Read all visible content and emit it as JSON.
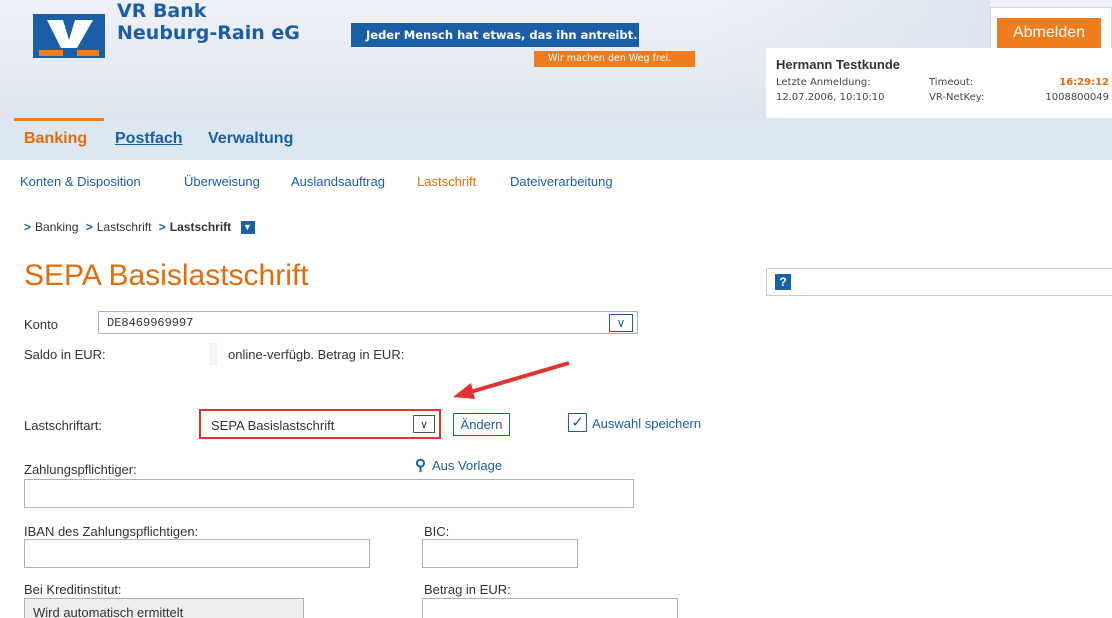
{
  "header": {
    "bank_name_line1": "VR Bank",
    "bank_name_line2": "Neuburg-Rain eG",
    "slogan": "Jeder Mensch hat etwas, das ihn antreibt.",
    "slogan_sub": "Wir machen den Weg frei.",
    "logout_label": "Abmelden"
  },
  "user": {
    "name": "Hermann Testkunde",
    "last_login_label": "Letzte Anmeldung:",
    "last_login_value": "12.07.2006, 10:10:10",
    "timeout_label": "Timeout:",
    "timeout_value": "16:29:12",
    "netkey_label": "VR-NetKey:",
    "netkey_value": "1008800049"
  },
  "mainnav": {
    "tabs": [
      "Banking",
      "Postfach",
      "Verwaltung"
    ],
    "active": "Banking"
  },
  "subnav": {
    "items": [
      "Konten & Disposition",
      "Überweisung",
      "Auslandsauftrag",
      "Lastschrift",
      "Dateiverarbeitung"
    ],
    "active": "Lastschrift"
  },
  "breadcrumb": {
    "items": [
      "Banking",
      "Lastschrift",
      "Lastschrift"
    ]
  },
  "page": {
    "title": "SEPA Basislastschrift",
    "help_icon_text": "?"
  },
  "form": {
    "konto_label": "Konto",
    "konto_value": "DE8469969997",
    "saldo_label": "Saldo in EUR:",
    "online_label": "online-verfügb. Betrag in EUR:",
    "lastschriftart_label": "Lastschriftart:",
    "lastschriftart_value": "SEPA Basislastschrift",
    "aendern_label": "Ändern",
    "auswahl_label": "Auswahl speichern",
    "auswahl_checked": true,
    "zahlungspflichtiger_label": "Zahlungspflichtiger:",
    "aus_vorlage_label": "Aus Vorlage",
    "iban_label": "IBAN des Zahlungspflichtigen:",
    "bic_label": "BIC:",
    "kreditinstitut_label": "Bei Kreditinstitut:",
    "kreditinstitut_value": "Wird automatisch ermittelt",
    "betrag_label": "Betrag in EUR:"
  },
  "colors": {
    "brand_blue": "#1a5ea8",
    "brand_orange": "#f07d1d",
    "title_orange": "#e46c0a",
    "highlight_red": "#e33232"
  },
  "icons": {
    "dropdown": "chevron-down-icon",
    "search": "search-icon",
    "checkbox": "checkmark-icon",
    "help": "help-icon"
  }
}
